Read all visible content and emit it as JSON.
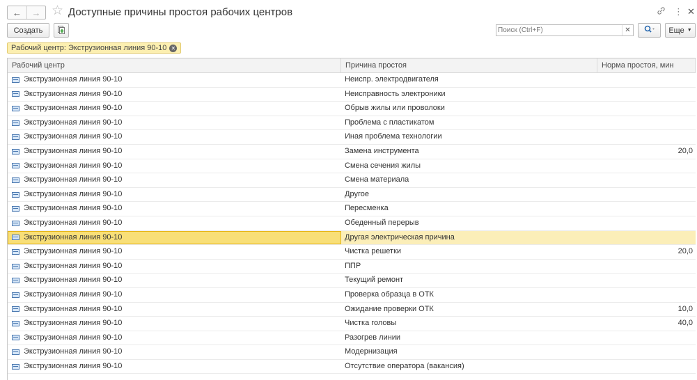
{
  "window": {
    "title": "Доступные причины простоя рабочих центров"
  },
  "icons": {
    "back": "arrow-left-icon",
    "forward": "arrow-right-icon",
    "favorite": "star-icon",
    "link": "link-icon",
    "more": "more-vertical-icon",
    "close": "close-icon",
    "add_copy": "copy-add-icon",
    "search": "search-icon",
    "row": "catalog-item-icon"
  },
  "toolbar": {
    "create_label": "Создать",
    "search_placeholder": "Поиск (Ctrl+F)",
    "more_label": "Еще"
  },
  "filter": {
    "label": "Рабочий центр: Экструзионная линия 90-10"
  },
  "table": {
    "columns": [
      "Рабочий центр",
      "Причина простоя",
      "Норма простоя, мин"
    ],
    "selected_index": 11,
    "rows": [
      {
        "center": "Экструзионная линия 90-10",
        "reason": "Неиспр. электродвигателя",
        "norm": ""
      },
      {
        "center": "Экструзионная линия 90-10",
        "reason": "Неисправность электроники",
        "norm": ""
      },
      {
        "center": "Экструзионная линия 90-10",
        "reason": "Обрыв жилы или проволоки",
        "norm": ""
      },
      {
        "center": "Экструзионная линия 90-10",
        "reason": "Проблема с пластикатом",
        "norm": ""
      },
      {
        "center": "Экструзионная линия 90-10",
        "reason": "Иная проблема технологии",
        "norm": ""
      },
      {
        "center": "Экструзионная линия 90-10",
        "reason": "Замена инструмента",
        "norm": "20,0"
      },
      {
        "center": "Экструзионная линия 90-10",
        "reason": "Смена сечения жилы",
        "norm": ""
      },
      {
        "center": "Экструзионная линия 90-10",
        "reason": "Смена материала",
        "norm": ""
      },
      {
        "center": "Экструзионная линия 90-10",
        "reason": "Другое",
        "norm": ""
      },
      {
        "center": "Экструзионная линия 90-10",
        "reason": "Пересменка",
        "norm": ""
      },
      {
        "center": "Экструзионная линия 90-10",
        "reason": "Обеденный перерыв",
        "norm": ""
      },
      {
        "center": "Экструзионная линия 90-10",
        "reason": "Другая электрическая причина",
        "norm": ""
      },
      {
        "center": "Экструзионная линия 90-10",
        "reason": "Чистка решетки",
        "norm": "20,0"
      },
      {
        "center": "Экструзионная линия 90-10",
        "reason": "ППР",
        "norm": ""
      },
      {
        "center": "Экструзионная линия 90-10",
        "reason": "Текущий ремонт",
        "norm": ""
      },
      {
        "center": "Экструзионная линия 90-10",
        "reason": "Проверка образца в ОТК",
        "norm": ""
      },
      {
        "center": "Экструзионная линия 90-10",
        "reason": "Ожидание проверки ОТК",
        "norm": "10,0"
      },
      {
        "center": "Экструзионная линия 90-10",
        "reason": "Чистка головы",
        "norm": "40,0"
      },
      {
        "center": "Экструзионная линия 90-10",
        "reason": "Разогрев линии",
        "norm": ""
      },
      {
        "center": "Экструзионная линия 90-10",
        "reason": "Модернизация",
        "norm": ""
      },
      {
        "center": "Экструзионная линия 90-10",
        "reason": "Отсутствие оператора (вакансия)",
        "norm": ""
      }
    ]
  }
}
